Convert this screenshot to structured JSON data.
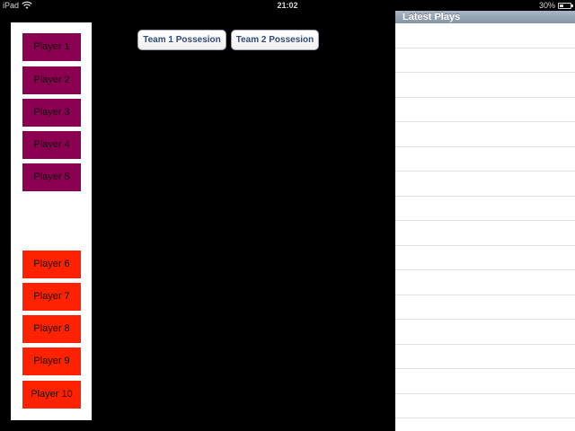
{
  "status_bar": {
    "carrier": "iPad",
    "time": "21:02",
    "battery_percent": "30%"
  },
  "roster": {
    "team1_color": "#8b0050",
    "team2_color": "#ff2200",
    "team1_players": [
      "Player 1",
      "Player 2",
      "Player 3",
      "Player 4",
      "Player 5"
    ],
    "team2_players": [
      "Player 6",
      "Player 7",
      "Player 8",
      "Player 9",
      "Player 10"
    ]
  },
  "possession": {
    "team1_label": "Team 1 Possesion",
    "team2_label": "Team 2 Possesion"
  },
  "plays": {
    "title": "Latest Plays",
    "rows": [
      "",
      "",
      "",
      "",
      "",
      "",
      "",
      "",
      "",
      "",
      "",
      "",
      "",
      "",
      "",
      ""
    ]
  }
}
